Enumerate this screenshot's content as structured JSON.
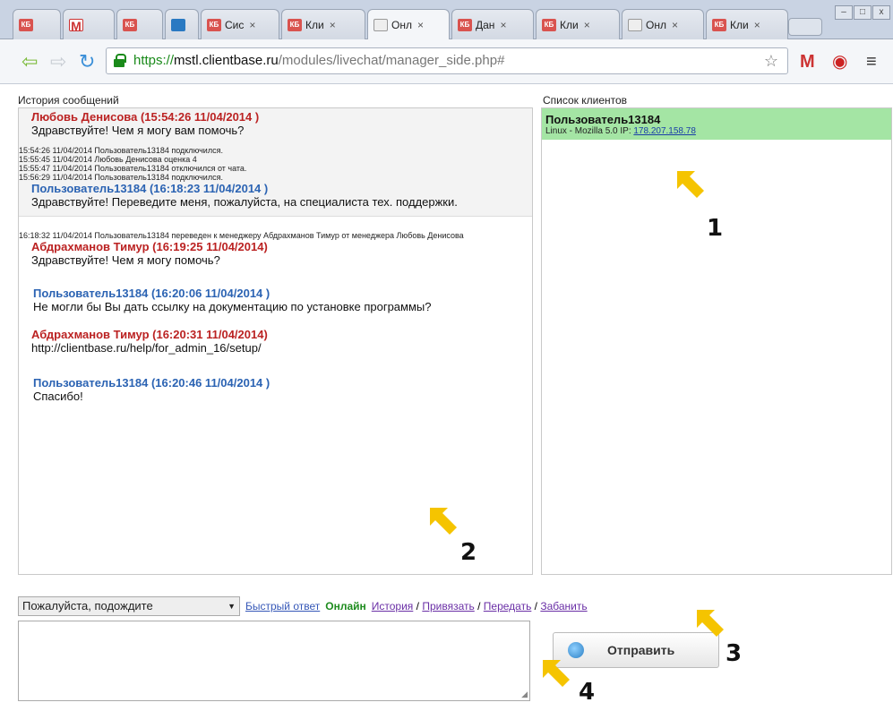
{
  "browser": {
    "tabs": [
      {
        "label": "",
        "icon": "kb-favicon-icon",
        "fav": "КБ"
      },
      {
        "label": "",
        "icon": "gmail-icon",
        "fav": "M"
      },
      {
        "label": "",
        "icon": "kb-favicon-icon",
        "fav": "КБ"
      },
      {
        "label": "",
        "icon": "trello-icon",
        "fav": ""
      },
      {
        "label": "Сис",
        "icon": "kb-favicon-icon",
        "fav": "КБ"
      },
      {
        "label": "Кли",
        "icon": "kb-favicon-icon",
        "fav": "КБ"
      },
      {
        "label": "Онл",
        "icon": "document-icon",
        "fav": ""
      },
      {
        "label": "Дан",
        "icon": "kb-favicon-icon",
        "fav": "КБ"
      },
      {
        "label": "Кли",
        "icon": "kb-favicon-icon",
        "fav": "КБ"
      },
      {
        "label": "Онл",
        "icon": "document-icon",
        "fav": ""
      },
      {
        "label": "Кли",
        "icon": "kb-favicon-icon",
        "fav": "КБ"
      }
    ],
    "url": {
      "scheme": "https://",
      "host": "mstl.clientbase.ru",
      "path": "/modules/livechat/manager_side.php#"
    }
  },
  "history": {
    "title": "История сообщений",
    "top_name": "Любовь Денисова (15:54:26 11/04/2014 )",
    "top_text": "Здравствуйте! Чем я могу вам помочь?",
    "events1": [
      "15:54:26 11/04/2014 Пользователь13184 подключился.",
      "15:55:45 11/04/2014 Любовь Денисова оценка 4",
      "15:55:47 11/04/2014 Пользователь13184 отключился от чата.",
      "15:56:29 11/04/2014 Пользователь13184 подключился."
    ],
    "user_msg1_name": "Пользователь13184 (16:18:23 11/04/2014 )",
    "user_msg1_text": "Здравствуйте! Переведите меня, пожалуйста, на специалиста тех. поддержки.",
    "transfer_event": "16:18:32 11/04/2014 Пользователь13184 переведен к менеджеру Абдрахманов Тимур от менеджера Любовь Денисова",
    "msg2_name": "Абдрахманов Тимур (16:19:25 11/04/2014)",
    "msg2_text": "Здравствуйте! Чем я могу помочь?",
    "msg3_name": "Пользователь13184 (16:20:06 11/04/2014 )",
    "msg3_text": "Не могли бы Вы дать ссылку на документацию по установке программы?",
    "msg4_name": "Абдрахманов Тимур (16:20:31 11/04/2014)",
    "msg4_text": "http://clientbase.ru/help/for_admin_16/setup/",
    "msg5_name": "Пользователь13184 (16:20:46 11/04/2014 )",
    "msg5_text": "Спасибо!"
  },
  "clients": {
    "title": "Список клиентов",
    "name": "Пользователь13184",
    "info": "Linux - Mozilla 5.0 IP: ",
    "ip": "178.207.158.78"
  },
  "controls": {
    "status_select": "Пожалуйста, подождите",
    "quick_reply": "Быстрый ответ",
    "online": "Онлайн",
    "history": "История",
    "bind": "Привязать",
    "transfer": "Передать",
    "ban": "Забанить",
    "sep": "/",
    "send": "Отправить"
  },
  "annotations": [
    "1",
    "2",
    "3",
    "4"
  ],
  "colors": {
    "arrow": "#f5c400",
    "manager": "#b22222",
    "user": "#2b63b3",
    "client_bg": "#a4e5a4"
  }
}
